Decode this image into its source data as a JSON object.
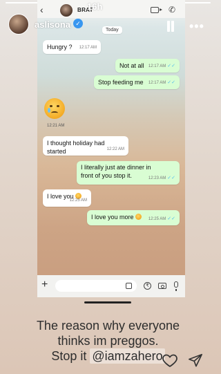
{
  "story": {
    "username": "aslisona",
    "time_ago": "16h",
    "progress": 1.0
  },
  "chat_header": {
    "contact_name": "BRAT"
  },
  "chat": {
    "date_chip": "Today",
    "messages": [
      {
        "dir": "in",
        "text": "Hungry ?",
        "time": "12:17 AM"
      },
      {
        "dir": "out",
        "text": "Not at all",
        "time": "12:17 AM"
      },
      {
        "dir": "out",
        "text": "Stop feeding me",
        "time": "12:17 AM"
      },
      {
        "dir": "in",
        "emoji": "crying-face",
        "time": "12:21 AM"
      },
      {
        "dir": "in",
        "text": "I thought holiday had started",
        "time": "12:22 AM"
      },
      {
        "dir": "out",
        "text": "I literally just ate dinner in front of you stop it.",
        "time": "12:23 AM"
      },
      {
        "dir": "in",
        "text": "I love you",
        "emoji": "kissing-heart-face",
        "time": "12:25 AM"
      },
      {
        "dir": "out",
        "text": "I love you more",
        "emoji": "kissing-heart-face",
        "time": "12:25 AM"
      }
    ],
    "input_placeholder": ""
  },
  "caption": {
    "line1": "The reason why everyone",
    "line2": "thinks im preggos.",
    "line3_prefix": "Stop it ",
    "mention": "@iamzahero"
  },
  "icons": {
    "verified": "verified-badge-icon",
    "pause": "pause-icon",
    "more": "more-icon",
    "heart": "heart-icon",
    "share": "share-icon"
  },
  "colors": {
    "outgoing_bubble": "#d9fdd3",
    "incoming_bubble": "#ffffff",
    "read_ticks": "#53bdeb",
    "verified": "#3897f0"
  }
}
